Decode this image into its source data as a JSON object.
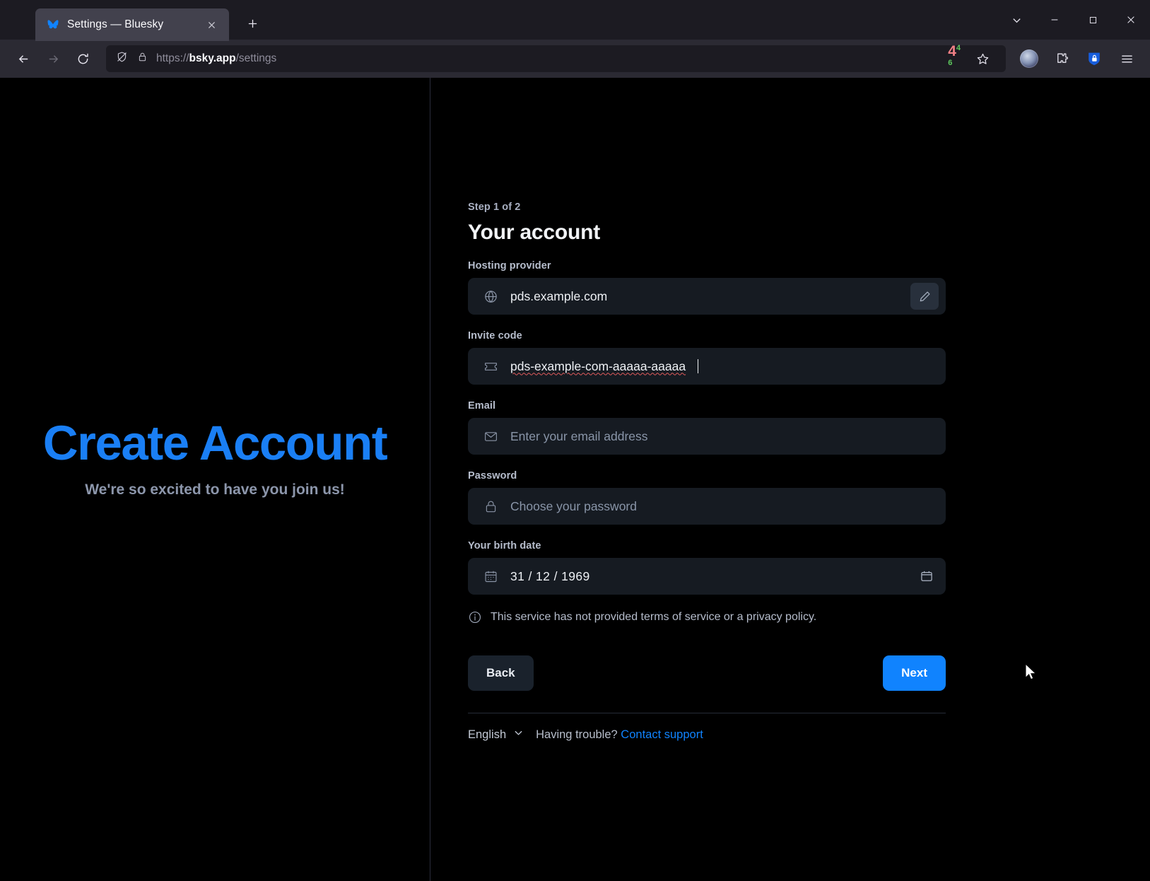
{
  "browser": {
    "tab": {
      "title": "Settings — Bluesky",
      "favicon": "bluesky-butterfly-icon",
      "close_label": "✕"
    },
    "new_tab_label": "+",
    "window_controls": {
      "list_all_tabs": "⌄",
      "minimize": "—",
      "maximize": "□",
      "close": "✕"
    },
    "nav": {
      "back": "←",
      "forward": "→",
      "reload": "⟳"
    },
    "url": {
      "scheme": "https://",
      "host": "bsky.app",
      "path": "/settings",
      "full": "https://bsky.app/settings"
    },
    "toolbar": {
      "tracker_count": "4",
      "tracker_sup_top": "4",
      "tracker_sup_bottom": "6",
      "bookmark_icon": "star-icon",
      "account_icon": "avatar-icon",
      "extensions_icon": "puzzle-piece-icon",
      "bitwarden_icon": "bitwarden-shield-icon",
      "menu_icon": "hamburger-menu-icon"
    }
  },
  "left_pane": {
    "title": "Create Account",
    "subtitle": "We're so excited to have you join us!"
  },
  "form": {
    "step": "Step 1 of 2",
    "title": "Your account",
    "fields": {
      "hosting_provider": {
        "label": "Hosting provider",
        "value": "pds.example.com",
        "icon": "globe-icon",
        "edit_icon": "pencil-icon"
      },
      "invite_code": {
        "label": "Invite code",
        "value": "pds-example-com-aaaaa-aaaaa",
        "icon": "ticket-icon"
      },
      "email": {
        "label": "Email",
        "value": "",
        "placeholder": "Enter your email address",
        "icon": "envelope-icon"
      },
      "password": {
        "label": "Password",
        "value": "",
        "placeholder": "Choose your password",
        "icon": "lock-icon"
      },
      "birth_date": {
        "label": "Your birth date",
        "value": "31 / 12 / 1969",
        "icon": "calendar-small-icon",
        "picker_icon": "calendar-picker-icon"
      }
    },
    "notice": {
      "icon": "info-circle-icon",
      "text": "This service has not provided terms of service or a privacy policy."
    },
    "buttons": {
      "back": "Back",
      "next": "Next"
    },
    "footer": {
      "language": "English",
      "language_chevron": "chevron-down-icon",
      "trouble_text": "Having trouble?",
      "support_link": "Contact support"
    }
  },
  "colors": {
    "accent": "#1083fe",
    "brand_title": "#1a7ff5",
    "page_bg": "#000000",
    "input_bg": "#161b22",
    "chrome_bg": "#1c1b22",
    "navbar_bg": "#2b2a33"
  }
}
